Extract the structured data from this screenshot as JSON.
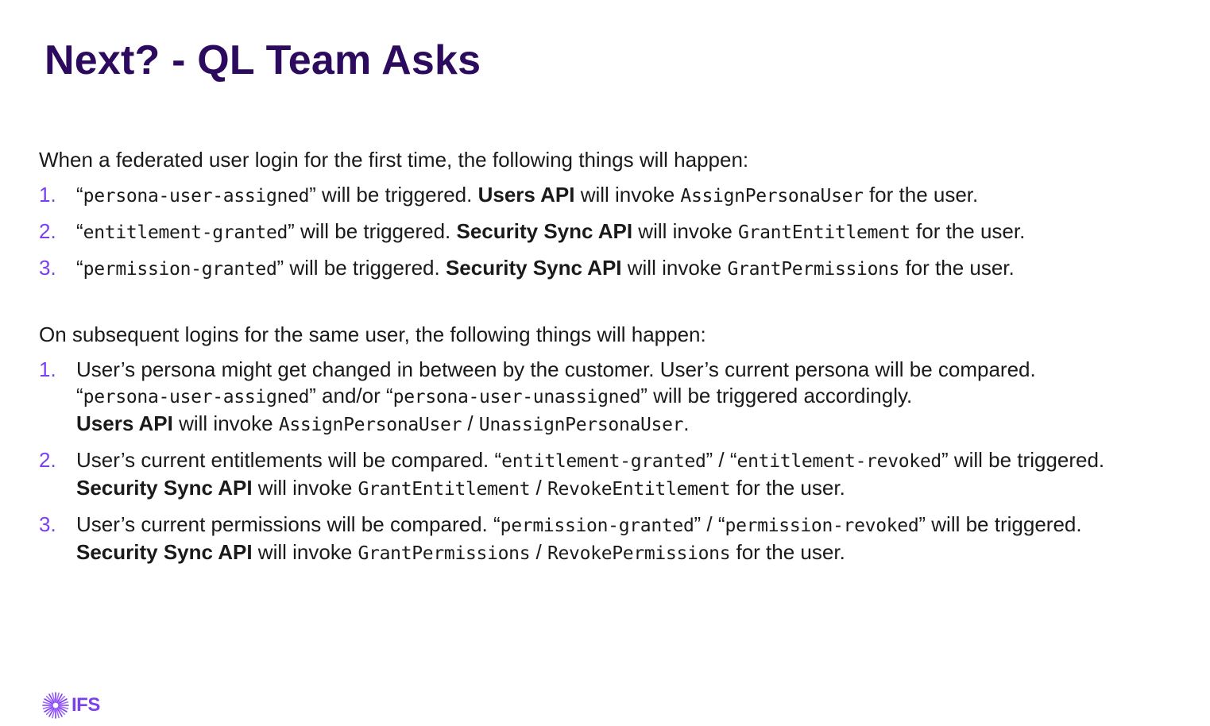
{
  "slide": {
    "title": "Next? - QL Team Asks"
  },
  "first_login": {
    "intro": "When a federated user login for the first time, the following things will happen:",
    "steps": [
      {
        "num": "1.",
        "lq": "“",
        "event": "persona-user-assigned",
        "rq_text": "” will be triggered. ",
        "api": "Users API",
        "invoke": " will invoke ",
        "method": "AssignPersonaUser",
        "tail": " for the user."
      },
      {
        "num": "2.",
        "lq": "“",
        "event": "entitlement-granted",
        "rq_text": "” will be triggered. ",
        "api": "Security Sync API",
        "invoke": " will invoke ",
        "method": "GrantEntitlement",
        "tail": " for the user."
      },
      {
        "num": "3.",
        "lq": "“",
        "event": "permission-granted",
        "rq_text": "” will be triggered. ",
        "api": "Security Sync API",
        "invoke": " will invoke ",
        "method": "GrantPermissions",
        "tail": " for the user."
      }
    ]
  },
  "subsequent_logins": {
    "intro": "On subsequent logins for the same user, the following things will happen:",
    "step1": {
      "num": "1.",
      "line1": "User’s persona might get changed in between by the customer. User’s current persona will be compared.",
      "l2_q1": "“",
      "l2_event1": "persona-user-assigned",
      "l2_mid": "” and/or “",
      "l2_event2": "persona-user-unassigned",
      "l2_tail": "” will be triggered accordingly.",
      "l3_api": "Users API",
      "l3_invoke": " will invoke ",
      "l3_method1": "AssignPersonaUser",
      "l3_sep": " / ",
      "l3_method2": "UnassignPersonaUser",
      "l3_tail": "."
    },
    "step2": {
      "num": "2.",
      "l1_text": "User’s current entitlements will be compared. “",
      "l1_event1": "entitlement-granted",
      "l1_mid": "” / “",
      "l1_event2": "entitlement-revoked",
      "l1_tail": "” will be triggered.",
      "l2_api": "Security Sync API",
      "l2_invoke": " will invoke ",
      "l2_method1": "GrantEntitlement",
      "l2_sep": " / ",
      "l2_method2": "RevokeEntitlement",
      "l2_tail": "  for the user."
    },
    "step3": {
      "num": "3.",
      "l1_text": "User’s current permissions will be compared. “",
      "l1_event1": "permission-granted",
      "l1_mid": "” / “",
      "l1_event2": "permission-revoked",
      "l1_tail": "” will be triggered.",
      "l2_api": "Security Sync API",
      "l2_invoke": " will invoke ",
      "l2_method1": "GrantPermissions",
      "l2_sep": " / ",
      "l2_method2": "RevokePermissions",
      "l2_tail": "  for the user."
    }
  },
  "footer": {
    "logo_text": "IFS",
    "logo_icon": "ifs-sunburst-icon"
  },
  "colors": {
    "title": "#2c0a5e",
    "accent": "#7b3ff0",
    "body_text": "#1a1a1a",
    "background": "#ffffff"
  }
}
